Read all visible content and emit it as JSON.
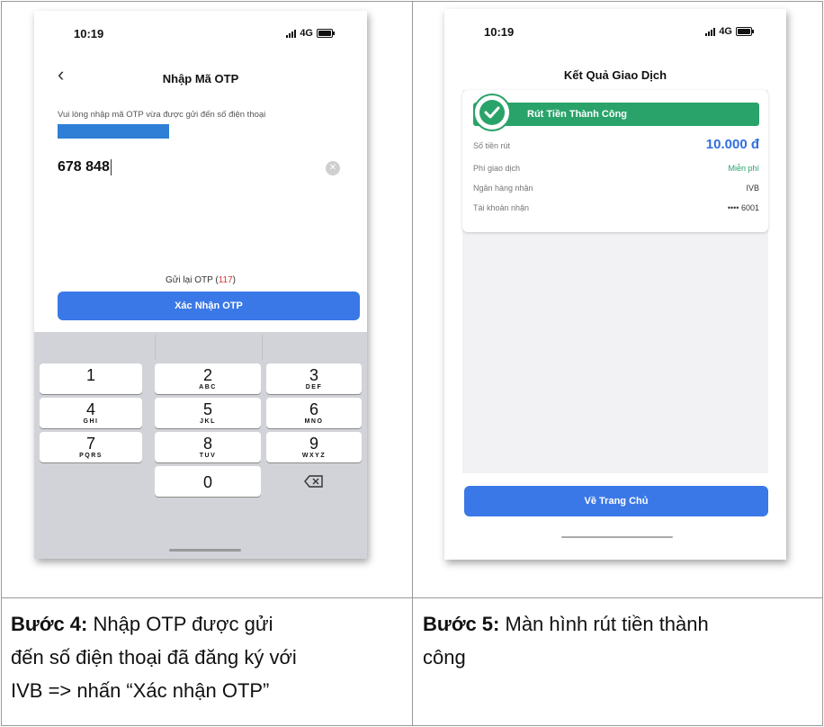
{
  "left_screen": {
    "time": "10:19",
    "network": "4G",
    "title": "Nhập Mã OTP",
    "hint": "Vui lòng nhập mã OTP vừa được gửi đến số điện thoại",
    "otp_value": "678 848",
    "resend_label": "Gửi lại OTP (",
    "resend_count": "117",
    "resend_close": ")",
    "confirm_button": "Xác Nhận OTP",
    "keys": [
      {
        "digit": "1",
        "letters": ""
      },
      {
        "digit": "2",
        "letters": "ABC"
      },
      {
        "digit": "3",
        "letters": "DEF"
      },
      {
        "digit": "4",
        "letters": "GHI"
      },
      {
        "digit": "5",
        "letters": "JKL"
      },
      {
        "digit": "6",
        "letters": "MNO"
      },
      {
        "digit": "7",
        "letters": "PQRS"
      },
      {
        "digit": "8",
        "letters": "TUV"
      },
      {
        "digit": "9",
        "letters": "WXYZ"
      },
      {
        "digit": "0",
        "letters": ""
      }
    ]
  },
  "right_screen": {
    "time": "10:19",
    "network": "4G",
    "title": "Kết Quả Giao Dịch",
    "banner": "Rút Tiền Thành Công",
    "rows": [
      {
        "label": "Số tiền rút",
        "value": "10.000 đ"
      },
      {
        "label": "Phí giao dịch",
        "value": "Miễn phí"
      },
      {
        "label": "Ngân hàng nhận",
        "value": "IVB"
      },
      {
        "label": "Tài khoản nhận",
        "value": "•••• 6001"
      }
    ],
    "home_button": "Về Trang Chủ"
  },
  "captions": {
    "step4_label": "Bước 4:",
    "step4_text": " Nhập OTP được gửi",
    "step4_line2": "đến số điện thoại đã đăng ký với",
    "step4_line3": "IVB => nhấn “Xác nhận OTP”",
    "step5_label": "Bước 5:",
    "step5_text": " Màn hình rút tiền thành",
    "step5_line2": "công"
  },
  "colors": {
    "accent_blue": "#3b78e7",
    "success_green": "#2aa36a",
    "countdown_red": "#d33333"
  }
}
